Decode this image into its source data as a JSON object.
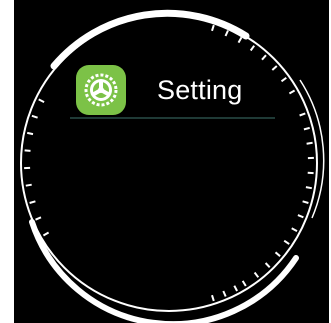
{
  "screen": {
    "title": "Setting",
    "app_icon": "gear-icon"
  },
  "colors": {
    "background": "#000000",
    "bezel": "#ffffff",
    "icon_green": "#7cc247",
    "divider": "#1f3a36",
    "text": "#ffffff"
  }
}
